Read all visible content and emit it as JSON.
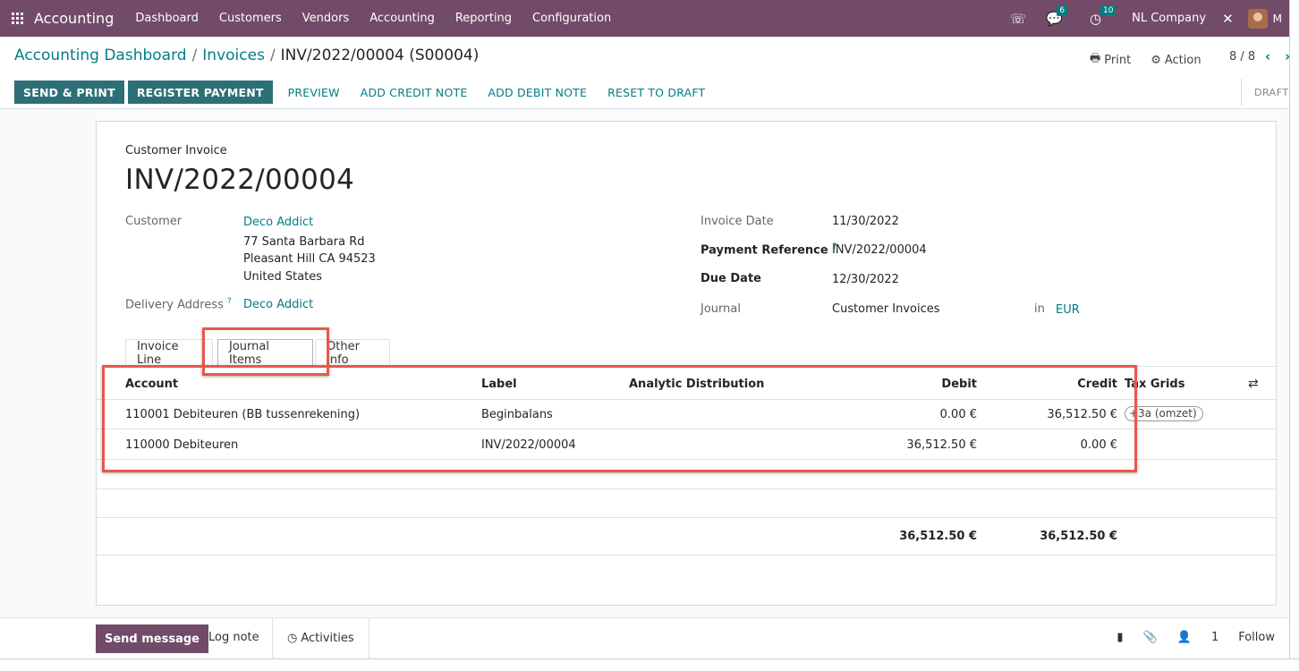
{
  "navbar": {
    "app_name": "Accounting",
    "menu": [
      "Dashboard",
      "Customers",
      "Vendors",
      "Accounting",
      "Reporting",
      "Configuration"
    ],
    "messages_count": "6",
    "activities_count": "10",
    "company": "NL Company",
    "user_initial": "M",
    "icons": [
      "apps-grid-icon",
      "phone-icon",
      "chat-icon",
      "clock-icon",
      "tools-icon"
    ]
  },
  "breadcrumb": {
    "items": [
      "Accounting Dashboard",
      "Invoices"
    ],
    "current": "INV/2022/00004 (S00004)"
  },
  "control": {
    "print": "Print",
    "action": "Action",
    "pager": "8 / 8"
  },
  "buttons": {
    "send_print": "SEND & PRINT",
    "register_payment": "REGISTER PAYMENT",
    "preview": "PREVIEW",
    "add_credit_note": "ADD CREDIT NOTE",
    "add_debit_note": "ADD DEBIT NOTE",
    "reset_to_draft": "RESET TO DRAFT",
    "status": "DRAFT"
  },
  "invoice": {
    "type": "Customer Invoice",
    "name": "INV/2022/00004",
    "customer_label": "Customer",
    "customer_name": "Deco Addict",
    "address_line1": "77 Santa Barbara Rd",
    "address_line2": "Pleasant Hill CA 94523",
    "address_line3": "United States",
    "delivery_label": "Delivery Address",
    "delivery_value": "Deco Addict",
    "invoice_date_label": "Invoice Date",
    "invoice_date": "11/30/2022",
    "payment_ref_label": "Payment Reference",
    "payment_ref": "INV/2022/00004",
    "due_date_label": "Due Date",
    "due_date": "12/30/2022",
    "journal_label": "Journal",
    "journal": "Customer Invoices",
    "in_label": "in",
    "currency": "EUR"
  },
  "tabs": [
    "Invoice Line",
    "Journal Items",
    "Other Info"
  ],
  "table": {
    "headers": {
      "account": "Account",
      "label": "Label",
      "analytic": "Analytic Distribution",
      "debit": "Debit",
      "credit": "Credit",
      "tax_grids": "Tax Grids"
    },
    "rows": [
      {
        "account": "110001 Debiteuren (BB tussenrekening)",
        "label": "Beginbalans",
        "debit": "0.00 €",
        "credit": "36,512.50 €",
        "tag": "+3a (omzet)"
      },
      {
        "account": "110000 Debiteuren",
        "label": "INV/2022/00004",
        "debit": "36,512.50 €",
        "credit": "0.00 €",
        "tag": ""
      }
    ],
    "total_debit": "36,512.50 €",
    "total_credit": "36,512.50 €"
  },
  "chatter": {
    "send_message": "Send message",
    "log_note": "Log note",
    "activities": "Activities",
    "followers_count": "1",
    "follow": "Follow"
  }
}
